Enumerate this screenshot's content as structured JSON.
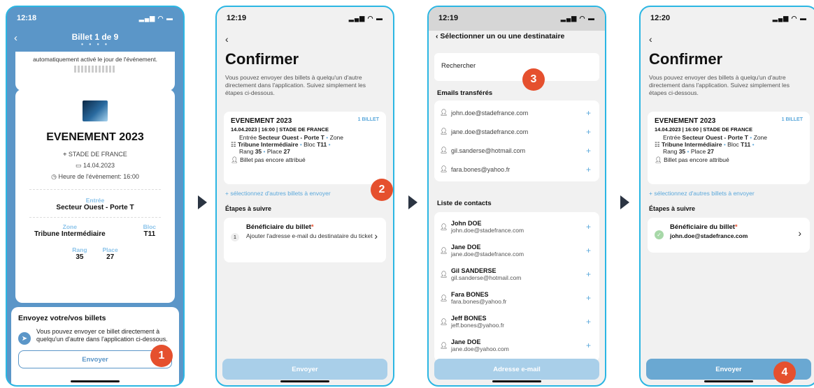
{
  "colors": {
    "accent": "#5b96c8",
    "badge": "#e5502e",
    "frame": "#2bb6e3",
    "link": "#5ba8db"
  },
  "steps": [
    "1",
    "2",
    "3",
    "4"
  ],
  "panel1": {
    "time": "12:18",
    "title": "Billet 1 de 9",
    "note": "automatiquement activé le jour de l'événement.",
    "event_title": "EVENEMENT 2023",
    "venue": "STADE DE FRANCE",
    "date": "14.04.2023",
    "event_time": "Heure de l'évènement: 16:00",
    "entree_label": "Entrée",
    "entree_value": "Secteur Ouest - Porte T",
    "zone_label": "Zone",
    "zone_value": "Tribune Intermédiaire",
    "bloc_label": "Bloc",
    "bloc_value": "T11",
    "rang_label": "Rang",
    "rang_value": "35",
    "place_label": "Place",
    "place_value": "27",
    "send_title": "Envoyez votre/vos billets",
    "send_text": "Vous pouvez envoyer ce billet directement à quelqu'un d'autre dans l'application ci-dessous.",
    "send_button": "Envoyer"
  },
  "panel2": {
    "time": "12:19",
    "title": "Confirmer",
    "subtitle": "Vous pouvez envoyer des billets à quelqu'un d'autre directement dans l'application. Suivez simplement les étapes ci-dessous.",
    "event": "EVENEMENT 2023",
    "count": "1 BILLET",
    "dateline": "14.04.2023 | 16:00 | STADE DE FRANCE",
    "entry_label": "Entrée",
    "entry_value": "Secteur Ouest - Porte T",
    "zone_label": "Zone",
    "zone_value": "Tribune Intermédiaire",
    "bloc_label": "Bloc",
    "bloc_value": "T11",
    "rang_label": "Rang",
    "rang_value": "35",
    "place_label": "Place",
    "place_value": "27",
    "status": "Billet pas encore attribué",
    "link": "+ sélectionnez d'autres billets à envoyer",
    "steps_title": "Étapes à suivre",
    "step_title": "Bénéficiaire du billet",
    "step_num": "1",
    "step_desc": "Ajouter l'adresse e-mail du destinataire du ticket",
    "button": "Envoyer"
  },
  "panel3": {
    "time": "12:19",
    "title": "Sélectionner un ou une destinataire",
    "search": "Rechercher",
    "emails_title": "Emails transférés",
    "emails": [
      "john.doe@stadefrance.com",
      "jane.doe@stadefrance.com",
      "gil.sanderse@hotmail.com",
      "fara.bones@yahoo.fr"
    ],
    "contacts_title": "Liste de contacts",
    "contacts": [
      {
        "name": "John DOE",
        "email": "john.doe@stadefrance.com"
      },
      {
        "name": "Jane DOE",
        "email": "jane.doe@stadefrance.com"
      },
      {
        "name": "Gil SANDERSE",
        "email": "gil.sanderse@hotmail.com"
      },
      {
        "name": "Fara BONES",
        "email": "fara.bones@yahoo.fr"
      },
      {
        "name": "Jeff BONES",
        "email": "jeff.bones@yahoo.fr"
      },
      {
        "name": "Jane DOE",
        "email": "jane.doe@yahoo.com"
      }
    ],
    "button": "Adresse e-mail"
  },
  "panel4": {
    "time": "12:20",
    "title": "Confirmer",
    "subtitle": "Vous pouvez envoyer des billets à quelqu'un d'autre directement dans l'application. Suivez simplement les étapes ci-dessous.",
    "event": "EVENEMENT 2023",
    "count": "1 BILLET",
    "dateline": "14.04.2023 | 16:00 | STADE DE FRANCE",
    "entry_label": "Entrée",
    "entry_value": "Secteur Ouest - Porte T",
    "zone_label": "Zone",
    "zone_value": "Tribune Intermédiaire",
    "bloc_label": "Bloc",
    "bloc_value": "T11",
    "rang_label": "Rang",
    "rang_value": "35",
    "place_label": "Place",
    "place_value": "27",
    "status": "Billet pas encore attribué",
    "link": "+ sélectionnez d'autres billets à envoyer",
    "steps_title": "Étapes à suivre",
    "step_title": "Bénéficiaire du billet",
    "step_value": "john.doe@stadefrance.com",
    "button": "Envoyer"
  }
}
